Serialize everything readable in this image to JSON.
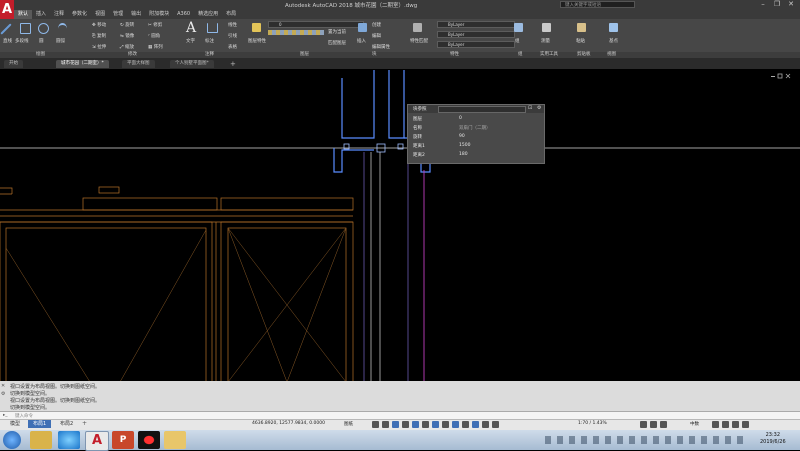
{
  "app": {
    "logo": "A",
    "title": "Autodesk AutoCAD 2018    城市花園（二期室）.dwg",
    "search_placeholder": "键入关键字或短语"
  },
  "ribbon_tabs": [
    "默认",
    "插入",
    "注释",
    "参数化",
    "视图",
    "管理",
    "输出",
    "附加模块",
    "A360",
    "精选应用",
    "布局"
  ],
  "ribbon": {
    "panels": [
      "绘图",
      "修改",
      "注释",
      "图层",
      "块",
      "特性",
      "组",
      "实用工具",
      "剪贴板",
      "视图"
    ],
    "tools": {
      "line": "直线",
      "polyline": "多段线",
      "circle": "圆",
      "arc": "圆弧",
      "move": "移动",
      "rotate": "旋转",
      "trim": "修剪",
      "copy": "复制",
      "mirror": "镜像",
      "fillet": "圆角",
      "stretch": "拉伸",
      "scale": "缩放",
      "array": "阵列",
      "text": "文字",
      "dimension": "标注",
      "linear": "线性",
      "leader": "引线",
      "table": "表格",
      "layer_props": "图层特性",
      "make_current": "置为当前",
      "match_layer": "匹配图层",
      "insert": "插入",
      "create": "创建",
      "edit": "编辑",
      "edit_attr": "编辑属性",
      "match_props": "特性匹配",
      "group": "组",
      "measure": "测量",
      "paste": "粘贴",
      "base": "基点"
    },
    "layer_value": "0",
    "bylayer": [
      "ByLayer",
      "ByLayer",
      "ByLayer"
    ]
  },
  "doc_tabs": [
    "开始",
    "城市花园（二期室）*",
    "平面大样图",
    "个人别墅平面图*"
  ],
  "block_props": {
    "title": "块参照",
    "rows": [
      {
        "label": "图层",
        "value": "0"
      },
      {
        "label": "名称",
        "value": "双扇门（二期）"
      },
      {
        "label": "旋转",
        "value": "90"
      },
      {
        "label": "距离1",
        "value": "1500"
      },
      {
        "label": "距离2",
        "value": "180"
      }
    ]
  },
  "command": {
    "lines": [
      "视口设置为布局视图。切换到图纸空间。",
      "切换到模型空间。",
      "视口设置为布局视图。切换到图纸空间。",
      "切换到模型空间。"
    ],
    "input_placeholder": "键入命令"
  },
  "layout_tabs": [
    "模型",
    "布局1",
    "布局2"
  ],
  "status": {
    "coords": "4636.8920, 12577.9834, 0.0000",
    "paper": "图纸",
    "scale": "1:70 / 1.43%",
    "annotation_scale": "中数"
  },
  "clock": {
    "time": "23:32",
    "date": "2019/6/26"
  },
  "colors": {
    "accent": "#3f6fb5",
    "autocad_red": "#c31d2a",
    "drawing_bg": "#000000"
  }
}
